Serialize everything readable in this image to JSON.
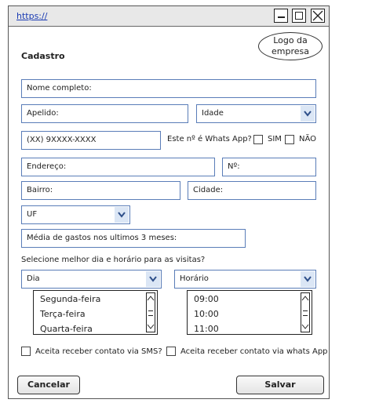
{
  "window": {
    "url": "https://",
    "minimize_label": "_"
  },
  "logo": {
    "line1": "Logo da",
    "line2": "empresa"
  },
  "form": {
    "title": "Cadastro",
    "nome_placeholder": "Nome completo:",
    "apelido_placeholder": "Apelido:",
    "idade_label": "Idade",
    "phone_placeholder": "(XX) 9XXXX-XXXX",
    "whatsapp_question": "Este nº é Whats App?",
    "sim_label": "SIM",
    "nao_label": "NÃO",
    "endereco_placeholder": "Endereço:",
    "numero_placeholder": "Nº:",
    "bairro_placeholder": "Bairro:",
    "cidade_placeholder": "Cidade:",
    "uf_label": "UF",
    "media_placeholder": "Média de gastos nos ultimos 3 meses:",
    "visit_prompt": "Selecione melhor dia e horário para as visitas?",
    "dia_label": "Dia",
    "horario_label": "Horário",
    "dias": [
      "Segunda-feira",
      "Terça-feira",
      "Quarta-feira"
    ],
    "horarios": [
      "09:00",
      "10:00",
      "11:00"
    ],
    "sms_label": "Aceita receber contato via SMS?",
    "whats_label": "Aceita receber contato via whats App"
  },
  "buttons": {
    "cancel": "Cancelar",
    "save": "Salvar"
  }
}
